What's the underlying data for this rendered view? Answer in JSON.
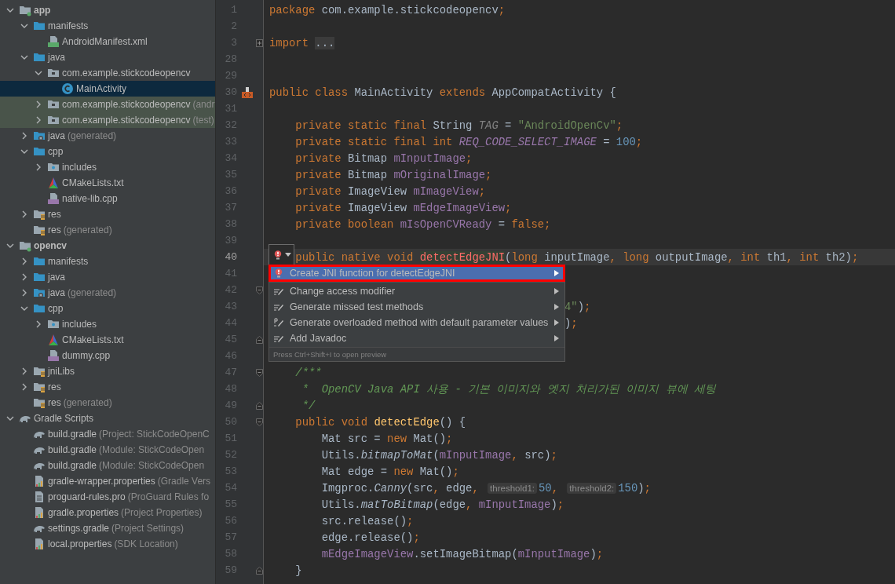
{
  "project_tree": [
    {
      "label": "app",
      "kind": "module",
      "expanded": true,
      "selected": false,
      "test_scope": false,
      "children": [
        {
          "label": "manifests",
          "kind": "folder",
          "expanded": true,
          "selected": false,
          "test_scope": false,
          "children": [
            {
              "label": "AndroidManifest.xml",
              "kind": "manifest",
              "selected": false,
              "test_scope": false
            }
          ]
        },
        {
          "label": "java",
          "kind": "folder",
          "expanded": true,
          "selected": false,
          "test_scope": false,
          "children": [
            {
              "label": "com.example.stickcodeopencv",
              "kind": "package",
              "expanded": true,
              "selected": false,
              "test_scope": false,
              "children": [
                {
                  "label": "MainActivity",
                  "kind": "class",
                  "selected": true,
                  "test_scope": false
                }
              ]
            },
            {
              "label": "com.example.stickcodeopencv",
              "hint": "(andr",
              "kind": "package",
              "expanded": false,
              "selected": false,
              "test_scope": true
            },
            {
              "label": "com.example.stickcodeopencv",
              "hint": "(test)",
              "kind": "package",
              "expanded": false,
              "selected": false,
              "test_scope": true
            }
          ]
        },
        {
          "label": "java",
          "hint": "(generated)",
          "kind": "generated",
          "expanded": false,
          "selected": false,
          "test_scope": false
        },
        {
          "label": "cpp",
          "kind": "folder",
          "expanded": true,
          "selected": false,
          "test_scope": false,
          "children": [
            {
              "label": "includes",
              "kind": "includes",
              "expanded": false,
              "selected": false,
              "test_scope": false
            },
            {
              "label": "CMakeLists.txt",
              "kind": "cmake",
              "selected": false,
              "test_scope": false
            },
            {
              "label": "native-lib.cpp",
              "kind": "cpp",
              "selected": false,
              "test_scope": false
            }
          ]
        },
        {
          "label": "res",
          "kind": "res",
          "expanded": false,
          "selected": false,
          "test_scope": false
        },
        {
          "label": "res",
          "hint": "(generated)",
          "kind": "res",
          "selected": false,
          "test_scope": false
        }
      ]
    },
    {
      "label": "opencv",
      "kind": "module",
      "expanded": true,
      "selected": false,
      "test_scope": false,
      "children": [
        {
          "label": "manifests",
          "kind": "folder",
          "expanded": false,
          "selected": false,
          "test_scope": false
        },
        {
          "label": "java",
          "kind": "folder",
          "expanded": false,
          "selected": false,
          "test_scope": false
        },
        {
          "label": "java",
          "hint": "(generated)",
          "kind": "generated",
          "expanded": false,
          "selected": false,
          "test_scope": false
        },
        {
          "label": "cpp",
          "kind": "folder",
          "expanded": true,
          "selected": false,
          "test_scope": false,
          "children": [
            {
              "label": "includes",
              "kind": "includes",
              "expanded": false,
              "selected": false,
              "test_scope": false
            },
            {
              "label": "CMakeLists.txt",
              "kind": "cmake",
              "selected": false,
              "test_scope": false
            },
            {
              "label": "dummy.cpp",
              "kind": "cpp",
              "selected": false,
              "test_scope": false
            }
          ]
        },
        {
          "label": "jniLibs",
          "kind": "res",
          "expanded": false,
          "selected": false,
          "test_scope": false
        },
        {
          "label": "res",
          "kind": "res",
          "expanded": false,
          "selected": false,
          "test_scope": false
        },
        {
          "label": "res",
          "hint": "(generated)",
          "kind": "res",
          "selected": false,
          "test_scope": false
        }
      ]
    },
    {
      "label": "Gradle Scripts",
      "kind": "gradle",
      "expanded": true,
      "selected": false,
      "test_scope": false,
      "children": [
        {
          "label": "build.gradle",
          "hint": "(Project: StickCodeOpenC",
          "kind": "gradle",
          "selected": false,
          "test_scope": false
        },
        {
          "label": "build.gradle",
          "hint": "(Module: StickCodeOpen",
          "kind": "gradle",
          "selected": false,
          "test_scope": false
        },
        {
          "label": "build.gradle",
          "hint": "(Module: StickCodeOpen",
          "kind": "gradle",
          "selected": false,
          "test_scope": false
        },
        {
          "label": "gradle-wrapper.properties",
          "hint": "(Gradle Vers",
          "kind": "properties",
          "selected": false,
          "test_scope": false
        },
        {
          "label": "proguard-rules.pro",
          "hint": "(ProGuard Rules fo",
          "kind": "text",
          "selected": false,
          "test_scope": false
        },
        {
          "label": "gradle.properties",
          "hint": "(Project Properties)",
          "kind": "properties",
          "selected": false,
          "test_scope": false
        },
        {
          "label": "settings.gradle",
          "hint": "(Project Settings)",
          "kind": "gradle",
          "selected": false,
          "test_scope": false
        },
        {
          "label": "local.properties",
          "hint": "(SDK Location)",
          "kind": "properties",
          "selected": false,
          "test_scope": false
        }
      ]
    }
  ],
  "editor": {
    "lines": [
      {
        "number": "1",
        "tokens": [
          {
            "kind": "kw",
            "text": "package "
          },
          {
            "kind": "plain",
            "text": "com.example.stickcodeopencv"
          },
          {
            "kind": "kw",
            "text": ";"
          }
        ]
      },
      {
        "number": "2"
      },
      {
        "number": "3",
        "fold": {
          "kind": "collapsed"
        },
        "tokens": [
          {
            "kind": "kw",
            "text": "import "
          },
          {
            "kind": "folded",
            "text": "..."
          }
        ]
      },
      {
        "number": "28"
      },
      {
        "number": "29"
      },
      {
        "number": "30",
        "marker": {
          "kind": "implemented"
        },
        "tokens": [
          {
            "kind": "kw",
            "text": "public class "
          },
          {
            "kind": "plain",
            "text": "MainActivity "
          },
          {
            "kind": "kw",
            "text": "extends "
          },
          {
            "kind": "plain",
            "text": "AppCompatActivity {"
          }
        ]
      },
      {
        "number": "31"
      },
      {
        "number": "32",
        "tokens": [
          {
            "kind": "kw",
            "text": "    private static final "
          },
          {
            "kind": "plain",
            "text": "String "
          },
          {
            "kind": "unused",
            "text": "TAG"
          },
          {
            "kind": "plain",
            "text": " = "
          },
          {
            "kind": "str",
            "text": "\"AndroidOpenCv\""
          },
          {
            "kind": "kw",
            "text": ";"
          }
        ]
      },
      {
        "number": "33",
        "tokens": [
          {
            "kind": "kw",
            "text": "    private static final int "
          },
          {
            "kind": "const",
            "text": "REQ_CODE_SELECT_IMAGE"
          },
          {
            "kind": "plain",
            "text": " = "
          },
          {
            "kind": "num",
            "text": "100"
          },
          {
            "kind": "kw",
            "text": ";"
          }
        ]
      },
      {
        "number": "34",
        "tokens": [
          {
            "kind": "kw",
            "text": "    private "
          },
          {
            "kind": "plain",
            "text": "Bitmap "
          },
          {
            "kind": "field",
            "text": "mInputImage"
          },
          {
            "kind": "kw",
            "text": ";"
          }
        ]
      },
      {
        "number": "35",
        "tokens": [
          {
            "kind": "kw",
            "text": "    private "
          },
          {
            "kind": "plain",
            "text": "Bitmap "
          },
          {
            "kind": "field",
            "text": "mOriginalImage"
          },
          {
            "kind": "kw",
            "text": ";"
          }
        ]
      },
      {
        "number": "36",
        "tokens": [
          {
            "kind": "kw",
            "text": "    private "
          },
          {
            "kind": "plain",
            "text": "ImageView "
          },
          {
            "kind": "field",
            "text": "mImageView"
          },
          {
            "kind": "kw",
            "text": ";"
          }
        ]
      },
      {
        "number": "37",
        "tokens": [
          {
            "kind": "kw",
            "text": "    private "
          },
          {
            "kind": "plain",
            "text": "ImageView "
          },
          {
            "kind": "field",
            "text": "mEdgeImageView"
          },
          {
            "kind": "kw",
            "text": ";"
          }
        ]
      },
      {
        "number": "38",
        "tokens": [
          {
            "kind": "kw",
            "text": "    private boolean "
          },
          {
            "kind": "field",
            "text": "mIsOpenCVReady"
          },
          {
            "kind": "plain",
            "text": " = "
          },
          {
            "kind": "kw",
            "text": "false;"
          }
        ]
      },
      {
        "number": "39"
      },
      {
        "number": "40",
        "current": true,
        "tokens": [
          {
            "kind": "kw",
            "text": "    public native void "
          },
          {
            "kind": "error",
            "text": "detectEdgeJNI"
          },
          {
            "kind": "plain",
            "text": "("
          },
          {
            "kind": "kw",
            "text": "long "
          },
          {
            "kind": "plain",
            "text": "inputImage"
          },
          {
            "kind": "kw",
            "text": ", long "
          },
          {
            "kind": "plain",
            "text": "outputImage"
          },
          {
            "kind": "kw",
            "text": ", int "
          },
          {
            "kind": "plain",
            "text": "th1"
          },
          {
            "kind": "kw",
            "text": ", int "
          },
          {
            "kind": "plain",
            "text": "th2)"
          },
          {
            "kind": "kw",
            "text": ";"
          }
        ]
      },
      {
        "number": "41"
      },
      {
        "number": "42",
        "fold": {
          "kind": "open"
        }
      },
      {
        "number": "43",
        "partial": true,
        "tokens": [
          {
            "kind": "str",
            "text": "4\""
          },
          {
            "kind": "plain",
            "text": ")"
          },
          {
            "kind": "kw",
            "text": ";"
          }
        ]
      },
      {
        "number": "44",
        "partial": true,
        "tokens": [
          {
            "kind": "plain",
            "text": ")"
          },
          {
            "kind": "kw",
            "text": ";"
          }
        ]
      },
      {
        "number": "45",
        "fold": {
          "kind": "close"
        }
      },
      {
        "number": "46"
      },
      {
        "number": "47",
        "fold": {
          "kind": "open"
        },
        "tokens": [
          {
            "kind": "comment",
            "text": "    /***"
          }
        ]
      },
      {
        "number": "48",
        "tokens": [
          {
            "kind": "comment",
            "text": "     *  OpenCV Java API 사용 - 기본 이미지와 엣지 처리가된 이미지 뷰에 세팅"
          }
        ]
      },
      {
        "number": "49",
        "fold": {
          "kind": "close"
        },
        "tokens": [
          {
            "kind": "comment",
            "text": "     */"
          }
        ]
      },
      {
        "number": "50",
        "fold": {
          "kind": "open"
        },
        "tokens": [
          {
            "kind": "kw",
            "text": "    public void "
          },
          {
            "kind": "method",
            "text": "detectEdge"
          },
          {
            "kind": "plain",
            "text": "() {"
          }
        ]
      },
      {
        "number": "51",
        "tokens": [
          {
            "kind": "plain",
            "text": "        Mat src = "
          },
          {
            "kind": "kw",
            "text": "new "
          },
          {
            "kind": "plain",
            "text": "Mat()"
          },
          {
            "kind": "kw",
            "text": ";"
          }
        ]
      },
      {
        "number": "52",
        "tokens": [
          {
            "kind": "plain",
            "text": "        Utils."
          },
          {
            "kind": "static",
            "text": "bitmapToMat"
          },
          {
            "kind": "plain",
            "text": "("
          },
          {
            "kind": "field",
            "text": "mInputImage"
          },
          {
            "kind": "kw",
            "text": ", "
          },
          {
            "kind": "plain",
            "text": "src)"
          },
          {
            "kind": "kw",
            "text": ";"
          }
        ]
      },
      {
        "number": "53",
        "tokens": [
          {
            "kind": "plain",
            "text": "        Mat edge = "
          },
          {
            "kind": "kw",
            "text": "new "
          },
          {
            "kind": "plain",
            "text": "Mat()"
          },
          {
            "kind": "kw",
            "text": ";"
          }
        ]
      },
      {
        "number": "54",
        "tokens": [
          {
            "kind": "plain",
            "text": "        Imgproc."
          },
          {
            "kind": "static",
            "text": "Canny"
          },
          {
            "kind": "plain",
            "text": "(src"
          },
          {
            "kind": "kw",
            "text": ", "
          },
          {
            "kind": "plain",
            "text": "edge"
          },
          {
            "kind": "kw",
            "text": ", "
          },
          {
            "kind": "hint",
            "text": "threshold1:"
          },
          {
            "kind": "num",
            "text": "50"
          },
          {
            "kind": "kw",
            "text": ", "
          },
          {
            "kind": "hint",
            "text": "threshold2:"
          },
          {
            "kind": "num",
            "text": "150"
          },
          {
            "kind": "plain",
            "text": ")"
          },
          {
            "kind": "kw",
            "text": ";"
          }
        ]
      },
      {
        "number": "55",
        "tokens": [
          {
            "kind": "plain",
            "text": "        Utils."
          },
          {
            "kind": "static",
            "text": "matToBitmap"
          },
          {
            "kind": "plain",
            "text": "(edge"
          },
          {
            "kind": "kw",
            "text": ", "
          },
          {
            "kind": "field",
            "text": "mInputImage"
          },
          {
            "kind": "plain",
            "text": ")"
          },
          {
            "kind": "kw",
            "text": ";"
          }
        ]
      },
      {
        "number": "56",
        "tokens": [
          {
            "kind": "plain",
            "text": "        src.release()"
          },
          {
            "kind": "kw",
            "text": ";"
          }
        ]
      },
      {
        "number": "57",
        "tokens": [
          {
            "kind": "plain",
            "text": "        edge.release()"
          },
          {
            "kind": "kw",
            "text": ";"
          }
        ]
      },
      {
        "number": "58",
        "tokens": [
          {
            "kind": "field",
            "text": "        mEdgeImageView"
          },
          {
            "kind": "plain",
            "text": ".setImageBitmap("
          },
          {
            "kind": "field",
            "text": "mInputImage"
          },
          {
            "kind": "plain",
            "text": ")"
          },
          {
            "kind": "kw",
            "text": ";"
          }
        ]
      },
      {
        "number": "59",
        "fold": {
          "kind": "close"
        },
        "tokens": [
          {
            "kind": "plain",
            "text": "    }"
          }
        ]
      }
    ]
  },
  "intention_menu": {
    "items": [
      {
        "label": "Create JNI function for detectEdgeJNI",
        "kind": "error",
        "selected": true,
        "outlined": true
      },
      {
        "label": "Change access modifier",
        "kind": "edit",
        "selected": false,
        "outlined": false
      },
      {
        "label": "Generate missed test methods",
        "kind": "edit",
        "selected": false,
        "outlined": false
      },
      {
        "label": "Generate overloaded method with default parameter values",
        "kind": "overload",
        "selected": false,
        "outlined": false
      },
      {
        "label": "Add Javadoc",
        "kind": "edit",
        "selected": false,
        "outlined": false
      }
    ],
    "footer": "Press Ctrl+Shift+I to open preview"
  }
}
